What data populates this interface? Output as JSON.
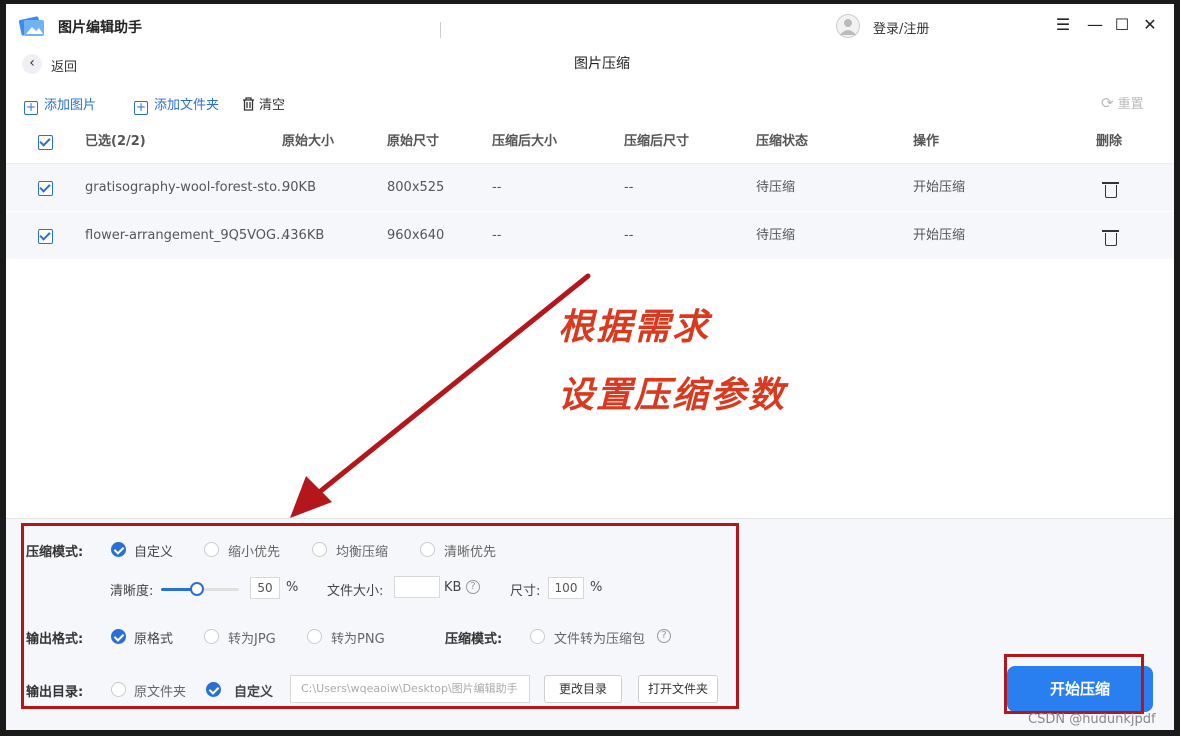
{
  "window": {
    "app_title": "图片编辑助手",
    "login_label": "登录/注册",
    "controls": [
      "☰",
      "—",
      "☐",
      "✕"
    ]
  },
  "nav": {
    "back_label": "返回",
    "page_title": "图片压缩"
  },
  "toolbar": {
    "add_image": "添加图片",
    "add_folder": "添加文件夹",
    "clear": "清空",
    "reset": "重置"
  },
  "table": {
    "headers": {
      "selected": "已选(2/2)",
      "orig_size": "原始大小",
      "orig_dim": "原始尺寸",
      "comp_size": "压缩后大小",
      "comp_dim": "压缩后尺寸",
      "status": "压缩状态",
      "action": "操作",
      "delete": "删除"
    },
    "rows": [
      {
        "name": "gratisography-wool-forest-sto...",
        "orig_size": "90KB",
        "orig_dim": "800x525",
        "comp_size": "--",
        "comp_dim": "--",
        "status": "待压缩",
        "action": "开始压缩"
      },
      {
        "name": "flower-arrangement_9Q5VOG...",
        "orig_size": "436KB",
        "orig_dim": "960x640",
        "comp_size": "--",
        "comp_dim": "--",
        "status": "待压缩",
        "action": "开始压缩"
      }
    ]
  },
  "annotation": {
    "line1": "根据需求",
    "line2": "设置压缩参数"
  },
  "settings": {
    "mode_label": "压缩模式:",
    "mode_options": [
      "自定义",
      "缩小优先",
      "均衡压缩",
      "清晰优先"
    ],
    "clarity_label": "清晰度:",
    "clarity_value": "50",
    "clarity_level": 0.5,
    "percent": "%",
    "filesize_label": "文件大小:",
    "filesize_value": "",
    "kb": "KB",
    "dim_label": "尺寸:",
    "dim_value": "100",
    "format_label": "输出格式:",
    "format_options": [
      "原格式",
      "转为JPG",
      "转为PNG"
    ],
    "pack_label": "压缩模式:",
    "pack_option": "文件转为压缩包",
    "dir_label": "输出目录:",
    "dir_options": [
      "原文件夹",
      "自定义"
    ],
    "dir_path": "C:\\Users\\wqeaoiw\\Desktop\\图片编辑助手",
    "change_dir": "更改目录",
    "open_folder": "打开文件夹",
    "start": "开始压缩"
  },
  "watermark": "CSDN @hudunkjpdf"
}
